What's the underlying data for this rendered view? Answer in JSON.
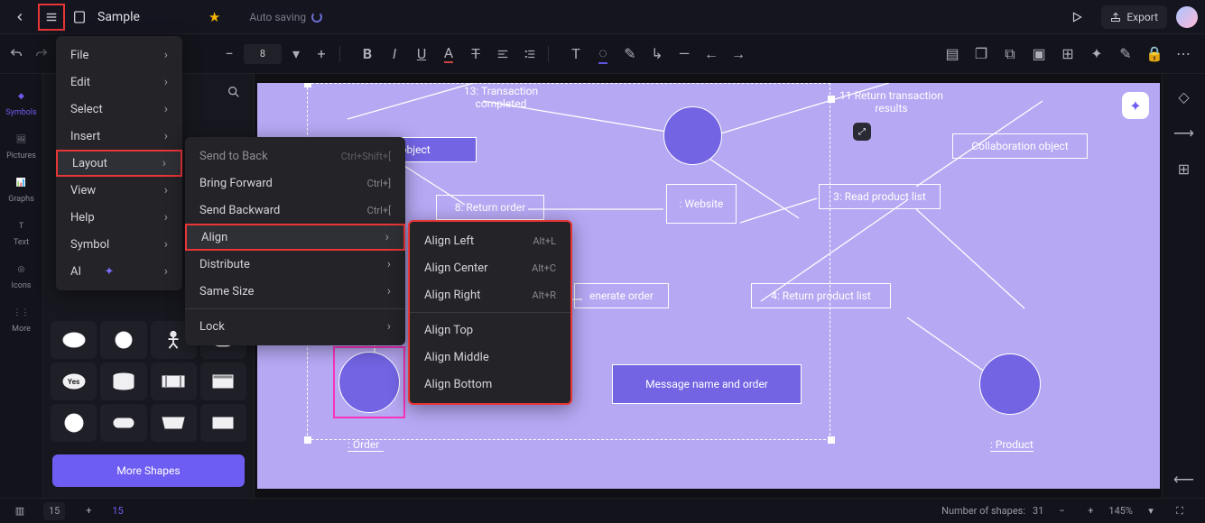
{
  "header": {
    "title": "Sample",
    "autosave_label": "Auto saving",
    "export_label": "Export"
  },
  "toolbar": {
    "font_size_value": "8"
  },
  "sidebar_left": {
    "items": [
      "Symbols",
      "Pictures",
      "Graphs",
      "Text",
      "Icons",
      "More"
    ]
  },
  "shape_panel": {
    "search_placeholder": "",
    "more_shapes_label": "More Shapes",
    "yes_label": "Yes"
  },
  "main_menu": {
    "items": [
      "File",
      "Edit",
      "Select",
      "Insert",
      "Layout",
      "View",
      "Help",
      "Symbol",
      "AI"
    ],
    "highlight_index": 4
  },
  "layout_menu": {
    "items": [
      {
        "label": "Send to Back",
        "shortcut": "Ctrl+Shift+["
      },
      {
        "label": "Bring Forward",
        "shortcut": "Ctrl+]"
      },
      {
        "label": "Send Backward",
        "shortcut": "Ctrl+["
      },
      {
        "label": "Align",
        "shortcut": "",
        "sub": true,
        "highlight": true
      },
      {
        "label": "Distribute",
        "shortcut": "",
        "sub": true
      },
      {
        "label": "Same Size",
        "shortcut": "",
        "sub": true
      },
      {
        "label": "Lock",
        "shortcut": "",
        "sub": true
      }
    ]
  },
  "align_menu": {
    "items": [
      {
        "label": "Align Left",
        "shortcut": "Alt+L"
      },
      {
        "label": "Align Center",
        "shortcut": "Alt+C"
      },
      {
        "label": "Align Right",
        "shortcut": "Alt+R"
      },
      {
        "label": "Align Top",
        "shortcut": ""
      },
      {
        "label": "Align Middle",
        "shortcut": ""
      },
      {
        "label": "Align Bottom",
        "shortcut": ""
      }
    ]
  },
  "canvas": {
    "nodes": {
      "n0": "13: Transaction completed",
      "n1": "11     Return transaction results",
      "n2": "ion object",
      "n3": "Collaboration object",
      "n4": "8: Return order",
      "n5": ": Website",
      "n6": "3: Read product list",
      "n7": "enerate order",
      "n8": "4: Return product list",
      "n9": "Message name and order",
      "n10": ": Order",
      "n11": ": Product"
    }
  },
  "statusbar": {
    "page_field": "15",
    "page_current": "15",
    "shape_count_label": "Number of shapes:",
    "shape_count": "31",
    "zoom": "145%"
  }
}
